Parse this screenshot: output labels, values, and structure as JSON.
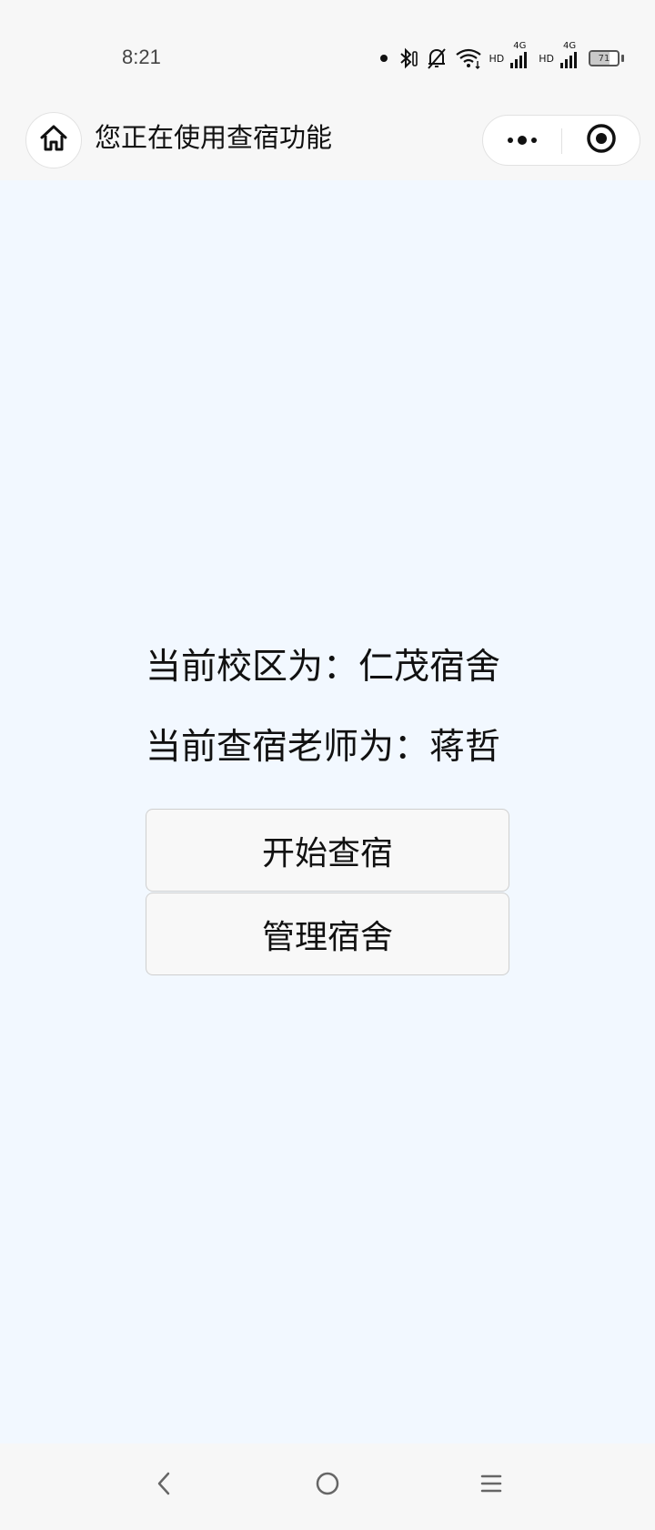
{
  "status_bar": {
    "time": "8:21",
    "network_label_1": "HD",
    "network_type_1": "4G",
    "network_label_2": "HD",
    "network_type_2": "4G",
    "battery_level": "71",
    "battery_fraction": 0.71
  },
  "nav": {
    "title": "您正在使用查宿功能"
  },
  "main": {
    "campus_line": "当前校区为：仁茂宿舍",
    "teacher_line": "当前查宿老师为：蒋哲",
    "start_button_label": "开始查宿",
    "manage_button_label": "管理宿舍"
  },
  "icons": {
    "home": "home-icon",
    "more": "more-dots-icon",
    "close": "close-target-icon",
    "back": "back-chevron-icon",
    "sys_home": "circle-home-icon",
    "menu": "menu-lines-icon",
    "bluetooth": "bluetooth-icon",
    "mute": "bell-off-icon",
    "wifi": "wifi-icon",
    "signal": "signal-icon",
    "battery": "battery-icon"
  }
}
